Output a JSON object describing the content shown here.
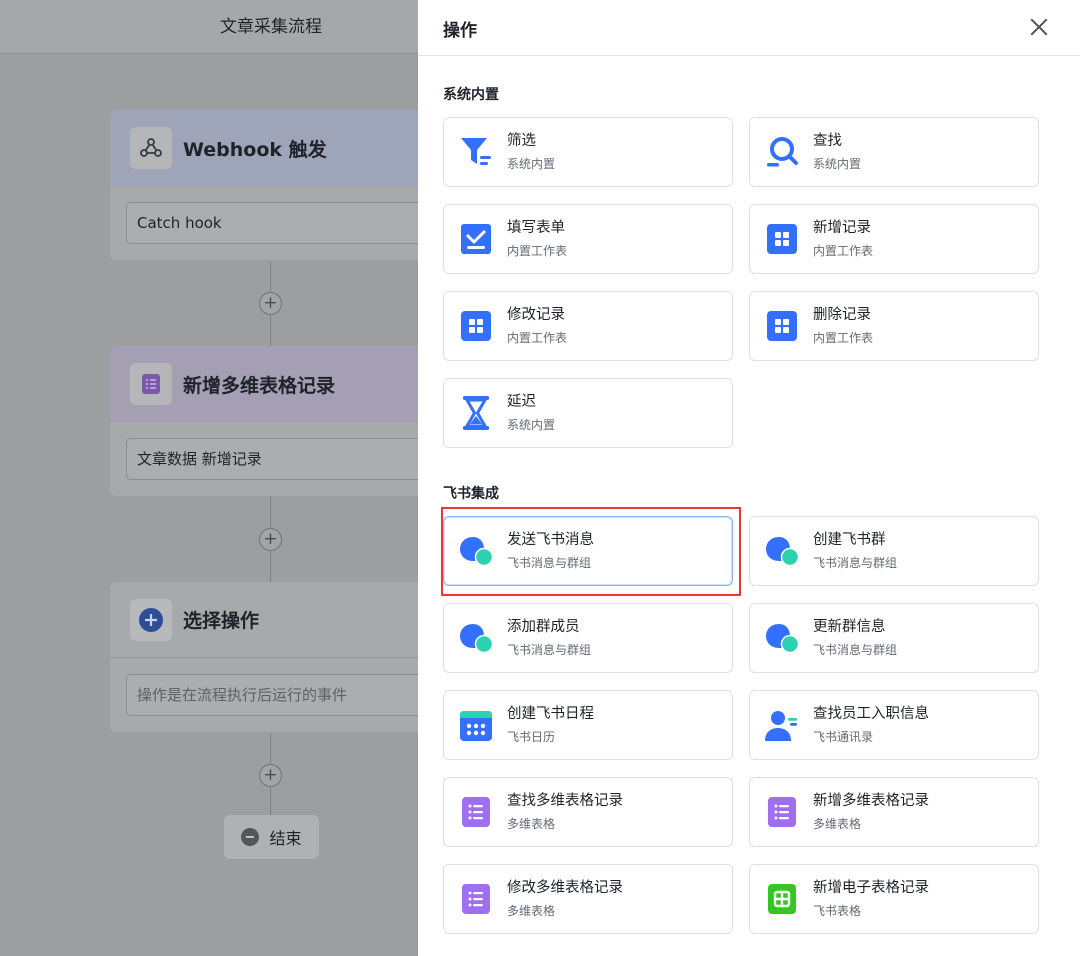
{
  "canvas": {
    "title": "文章采集流程",
    "nodes": [
      {
        "label": "Webhook 触发",
        "icon": "webhook-icon",
        "field": "Catch hook"
      },
      {
        "label": "新增多维表格记录",
        "icon": "bitable-icon",
        "field": "文章数据 新增记录"
      },
      {
        "label": "选择操作",
        "icon": "add-circle-icon",
        "field_placeholder": "操作是在流程执行后运行的事件"
      }
    ],
    "plus_symbol": "+",
    "end_label": "结束"
  },
  "panel": {
    "title": "操作",
    "sections": [
      {
        "title": "系统内置",
        "items": [
          {
            "name": "筛选",
            "sub": "系统内置",
            "icon": "filter-icon"
          },
          {
            "name": "查找",
            "sub": "系统内置",
            "icon": "search-icon"
          },
          {
            "name": "填写表单",
            "sub": "内置工作表",
            "icon": "form-icon"
          },
          {
            "name": "新增记录",
            "sub": "内置工作表",
            "icon": "grid-icon"
          },
          {
            "name": "修改记录",
            "sub": "内置工作表",
            "icon": "grid-icon"
          },
          {
            "name": "删除记录",
            "sub": "内置工作表",
            "icon": "grid-icon"
          },
          {
            "name": "延迟",
            "sub": "系统内置",
            "icon": "hourglass-icon"
          }
        ]
      },
      {
        "title": "飞书集成",
        "items": [
          {
            "name": "发送飞书消息",
            "sub": "飞书消息与群组",
            "icon": "chat-icon"
          },
          {
            "name": "创建飞书群",
            "sub": "飞书消息与群组",
            "icon": "chat-icon"
          },
          {
            "name": "添加群成员",
            "sub": "飞书消息与群组",
            "icon": "chat-icon"
          },
          {
            "name": "更新群信息",
            "sub": "飞书消息与群组",
            "icon": "chat-icon"
          },
          {
            "name": "创建飞书日程",
            "sub": "飞书日历",
            "icon": "calendar-icon"
          },
          {
            "name": "查找员工入职信息",
            "sub": "飞书通讯录",
            "icon": "contact-icon"
          },
          {
            "name": "查找多维表格记录",
            "sub": "多维表格",
            "icon": "bitable-icon"
          },
          {
            "name": "新增多维表格记录",
            "sub": "多维表格",
            "icon": "bitable-icon"
          },
          {
            "name": "修改多维表格记录",
            "sub": "多维表格",
            "icon": "bitable-icon"
          },
          {
            "name": "新增电子表格记录",
            "sub": "飞书表格",
            "icon": "sheet-icon"
          }
        ]
      }
    ]
  },
  "colors": {
    "blue": "#3370ff",
    "teal": "#2bd2b0",
    "purple": "#9f6ff0",
    "green": "#34c724",
    "highlight_border": "#e53935"
  }
}
